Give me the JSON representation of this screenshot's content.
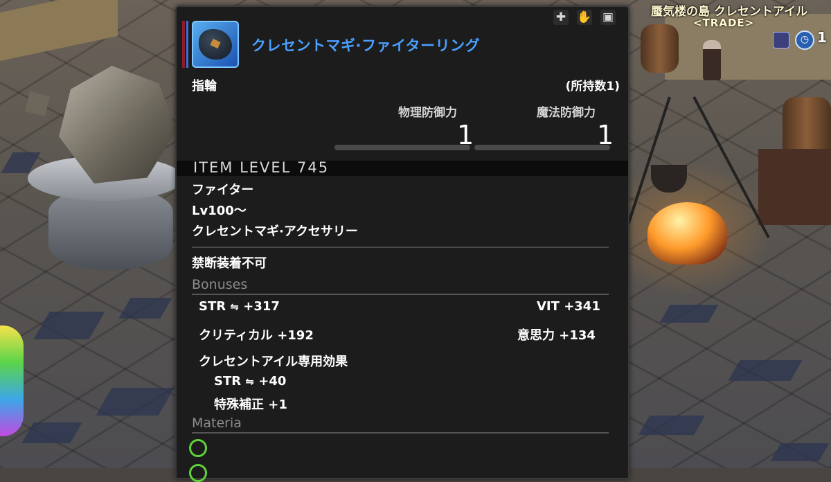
{
  "hud": {
    "location_title": "蜃気楼の島 クレセントアイル",
    "trade_label": "<TRADE>",
    "clock_icon": "clock-icon",
    "time_partial": "1"
  },
  "tooltip": {
    "item_name": "クレセントマギ·ファイターリング",
    "category": "指輪",
    "owned_count": "(所持数1)",
    "physical_def_label": "物理防御力",
    "physical_def_value": "1",
    "magic_def_label": "魔法防御力",
    "magic_def_value": "1",
    "item_level": "ITEM LEVEL 745",
    "job": "ファイター",
    "level_req": "Lv100～",
    "series": "クレセントマギ·アクセサリー",
    "forbidden": "禁断装着不可",
    "bonuses_header": "Bonuses",
    "bonuses": [
      {
        "name": "STR",
        "value": "+317"
      },
      {
        "name": "VIT",
        "value": "+341"
      },
      {
        "name": "クリティカル",
        "value": "+192"
      },
      {
        "name": "意思力",
        "value": "+134"
      }
    ],
    "special_effect_header": "クレセントアイル専用効果",
    "special_effects": [
      {
        "name": "STR",
        "value": "+40"
      },
      {
        "name": "特殊補正",
        "value": "+1"
      }
    ],
    "materia_header": "Materia",
    "colors": {
      "name": "#4aa0ff",
      "green": "#6fe04a",
      "panel": "#1c1c1c"
    }
  }
}
